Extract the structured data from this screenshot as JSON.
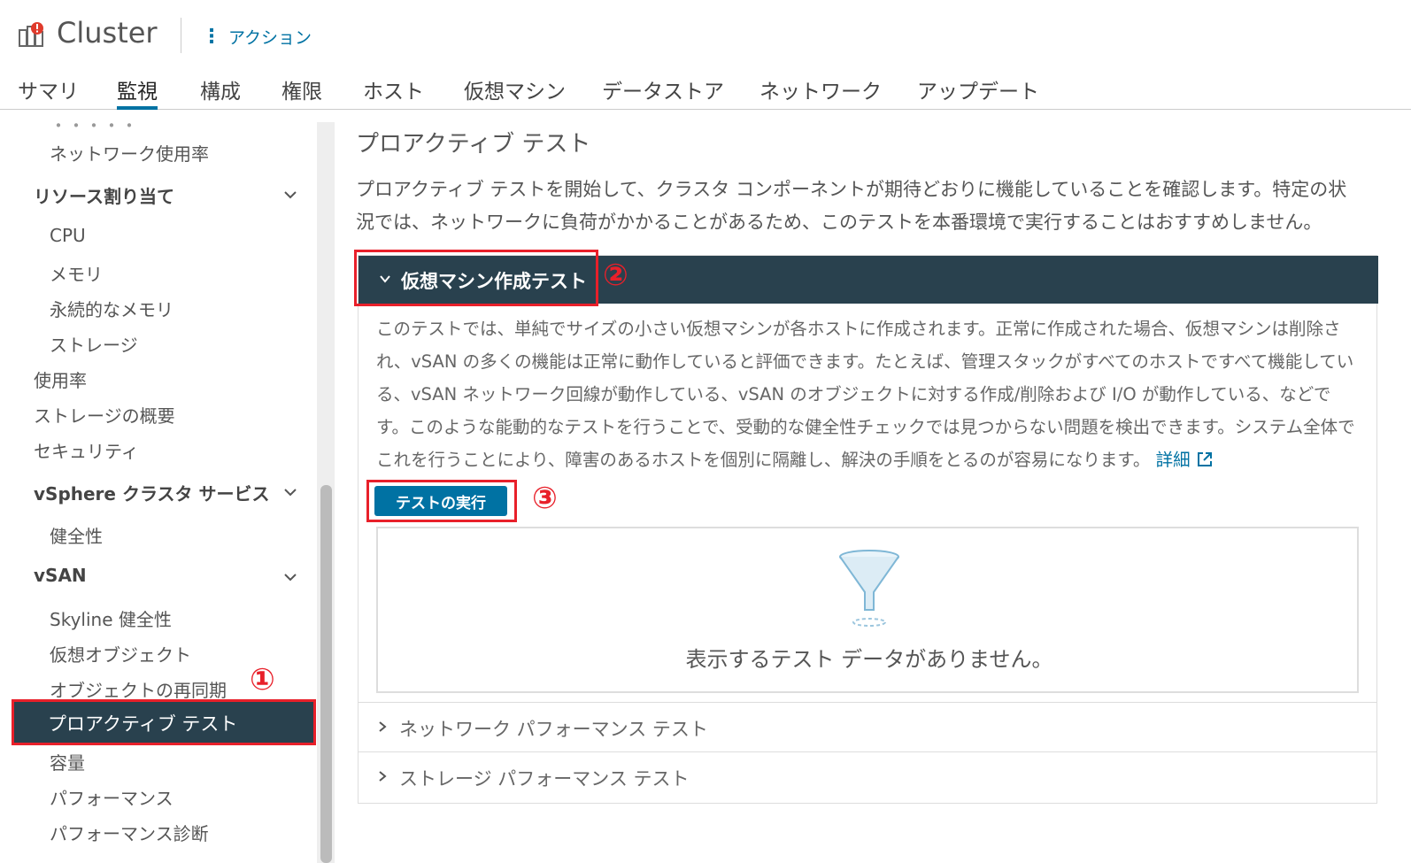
{
  "header": {
    "title": "Cluster",
    "actions_label": "アクション",
    "icon": "cluster-alert-icon"
  },
  "tabs": [
    {
      "label": "サマリ"
    },
    {
      "label": "監視",
      "active": true
    },
    {
      "label": "構成"
    },
    {
      "label": "権限"
    },
    {
      "label": "ホスト"
    },
    {
      "label": "仮想マシン"
    },
    {
      "label": "データストア"
    },
    {
      "label": "ネットワーク"
    },
    {
      "label": "アップデート"
    }
  ],
  "sidebar": {
    "items": [
      {
        "label": "ネットワーク使用率"
      },
      {
        "label": "リソース割り当て"
      },
      {
        "label": "CPU"
      },
      {
        "label": "メモリ"
      },
      {
        "label": "永続的なメモリ"
      },
      {
        "label": "ストレージ"
      },
      {
        "label": "使用率"
      },
      {
        "label": "ストレージの概要"
      },
      {
        "label": "セキュリティ"
      },
      {
        "label": "vSphere クラスタ サービス"
      },
      {
        "label": "健全性"
      },
      {
        "label": "vSAN"
      },
      {
        "label": "Skyline 健全性"
      },
      {
        "label": "仮想オブジェクト"
      },
      {
        "label": "オブジェクトの再同期"
      },
      {
        "label": "プロアクティブ テスト",
        "selected": true
      },
      {
        "label": "容量"
      },
      {
        "label": "パフォーマンス"
      },
      {
        "label": "パフォーマンス診断"
      }
    ]
  },
  "main": {
    "title": "プロアクティブ テスト",
    "description": "プロアクティブ テストを開始して、クラスタ コンポーネントが期待どおりに機能していることを確認します。特定の状況では、ネットワークに負荷がかかることがあるため、このテストを本番環境で実行することはおすすめしません。",
    "sections": [
      {
        "label": "仮想マシン作成テスト",
        "expanded": true,
        "body": "このテストでは、単純でサイズの小さい仮想マシンが各ホストに作成されます。正常に作成された場合、仮想マシンは削除され、vSAN の多くの機能は正常に動作していると評価できます。たとえば、管理スタックがすべてのホストですべて機能している、vSAN ネットワーク回線が動作している、vSAN のオブジェクトに対する作成/削除および I/O が動作している、などです。このような能動的なテストを行うことで、受動的な健全性チェックでは見つからない問題を検出できます。システム全体でこれを行うことにより、障害のあるホストを個別に隔離し、解決の手順をとるのが容易になります。",
        "details_link": "詳細",
        "run_button": "テストの実行",
        "empty_message": "表示するテスト データがありません。"
      },
      {
        "label": "ネットワーク パフォーマンス テスト",
        "expanded": false
      },
      {
        "label": "ストレージ パフォーマンス テスト",
        "expanded": false
      }
    ]
  },
  "annotations": [
    "①",
    "②",
    "③"
  ],
  "colors": {
    "accent": "#0072a3",
    "header_dark": "#29414e",
    "highlight_red": "#e8202a"
  }
}
